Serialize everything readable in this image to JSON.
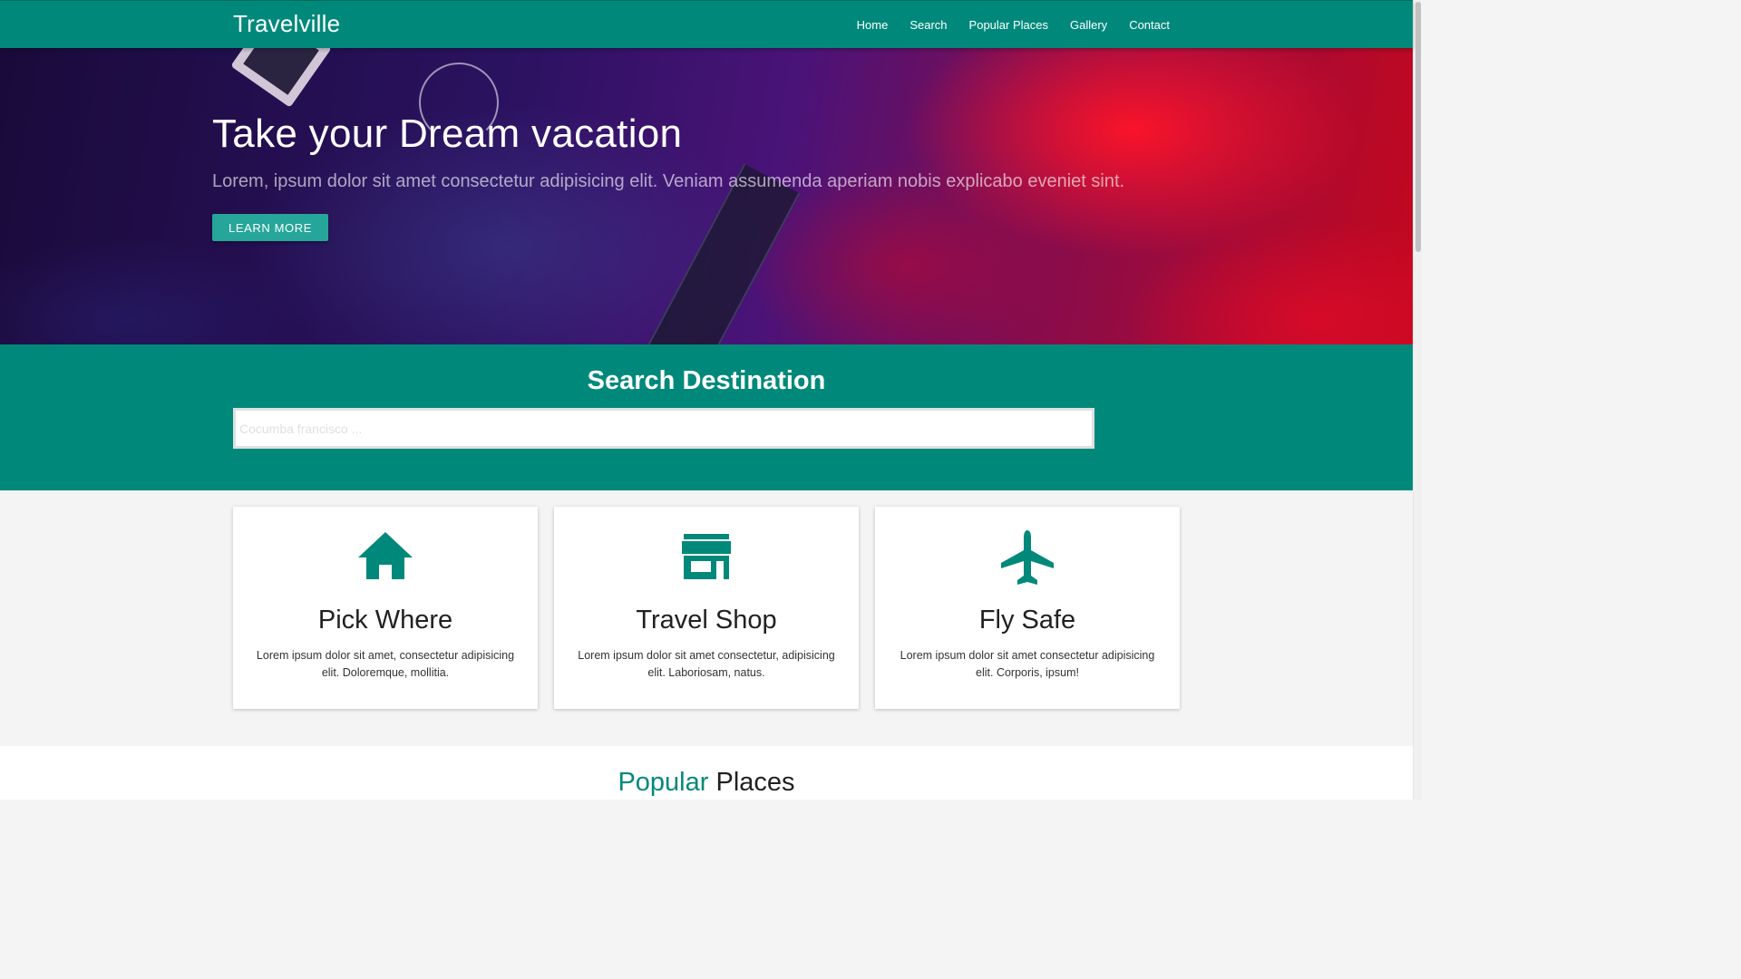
{
  "navbar": {
    "brand": "Travelville",
    "links": [
      "Home",
      "Search",
      "Popular Places",
      "Gallery",
      "Contact"
    ]
  },
  "hero": {
    "title": "Take your Dream vacation",
    "subtitle": "Lorem, ipsum dolor sit amet consectetur adipisicing elit. Veniam assumenda aperiam nobis explicabo eveniet sint.",
    "button_label": "Learn More"
  },
  "search": {
    "title": "Search Destination",
    "placeholder": "Cocumba francisco ..."
  },
  "features": [
    {
      "icon": "home-icon",
      "title": "Pick Where",
      "text": "Lorem ipsum dolor sit amet, consectetur adipisicing elit. Doloremque, mollitia."
    },
    {
      "icon": "store-icon",
      "title": "Travel Shop",
      "text": "Lorem ipsum dolor sit amet consectetur, adipisicing elit. Laboriosam, natus."
    },
    {
      "icon": "airplane-icon",
      "title": "Fly Safe",
      "text": "Lorem ipsum dolor sit amet consectetur adipisicing elit. Corporis, ipsum!"
    }
  ],
  "popular": {
    "title_accent": "Popular",
    "title_rest": "Places"
  },
  "colors": {
    "primary": "#00897b",
    "button": "#26a69a"
  }
}
